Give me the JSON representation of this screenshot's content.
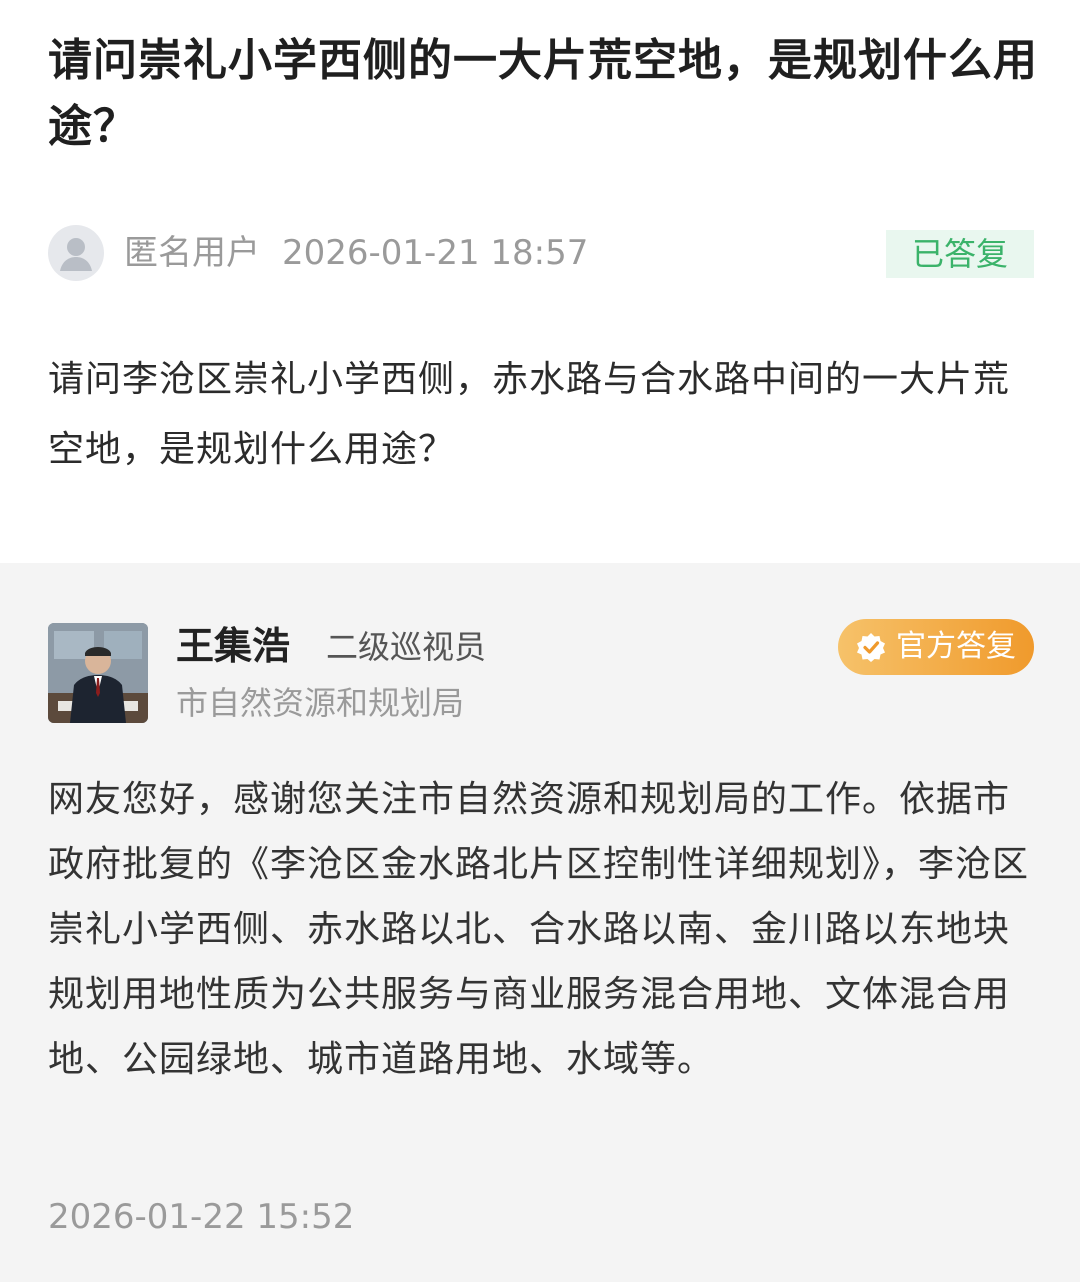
{
  "question": {
    "title": "请问崇礼小学西侧的一大片荒空地，是规划什么用途？",
    "asker_name": "匿名用户",
    "asked_at": "2026-01-21 18:57",
    "status": "已答复",
    "body": "请问李沧区崇礼小学西侧，赤水路与合水路中间的一大片荒空地，是规划什么用途？"
  },
  "answer": {
    "official_name": "王集浩",
    "official_title": "二级巡视员",
    "department": "市自然资源和规划局",
    "badge": "官方答复",
    "body": "网友您好，感谢您关注市自然资源和规划局的工作。依据市政府批复的《李沧区金水路北片区控制性详细规划》，李沧区崇礼小学西侧、赤水路以北、合水路以南、金川路以东地块规划用地性质为公共服务与商业服务混合用地、文体混合用地、公园绿地、城市道路用地、水域等。",
    "answered_at": "2026-01-22 15:52"
  },
  "icons": {
    "asker_avatar": "default-user-avatar-icon",
    "badge_icon": "verified-check-icon"
  },
  "colors": {
    "status_green": "#3bb36a",
    "status_bg": "#e9f7ef",
    "badge_orange": "#f09a2c",
    "answer_bg": "#f4f4f4"
  }
}
